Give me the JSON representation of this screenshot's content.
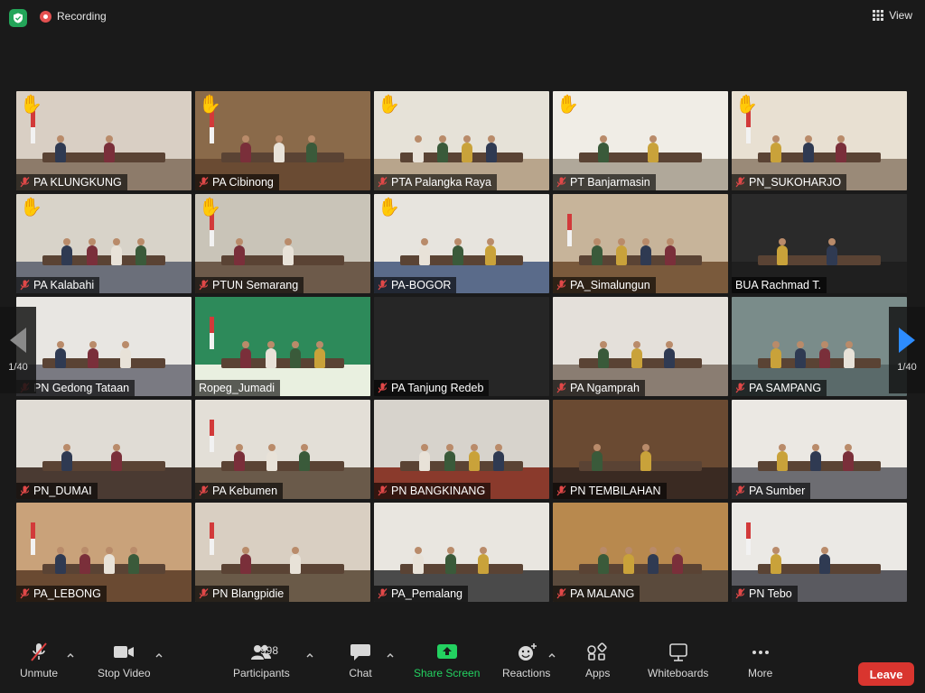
{
  "topbar": {
    "recording_label": "Recording",
    "view_label": "View",
    "icons": [
      "shield-icon",
      "recording-icon",
      "grid-view-icon"
    ]
  },
  "pagination": {
    "left_label": "1/40",
    "right_label": "1/40"
  },
  "participants": [
    {
      "name": "PA KLUNGKUNG",
      "hand_raised": true,
      "muted": true
    },
    {
      "name": "PA Cibinong",
      "hand_raised": true,
      "muted": true
    },
    {
      "name": "PTA Palangka Raya",
      "hand_raised": true,
      "muted": true
    },
    {
      "name": "PT Banjarmasin",
      "hand_raised": true,
      "muted": true
    },
    {
      "name": "PN_SUKOHARJO",
      "hand_raised": true,
      "muted": true
    },
    {
      "name": "PA Kalabahi",
      "hand_raised": true,
      "muted": true
    },
    {
      "name": "PTUN Semarang",
      "hand_raised": true,
      "muted": true
    },
    {
      "name": "PA-BOGOR",
      "hand_raised": true,
      "muted": true
    },
    {
      "name": "PA_Simalungun",
      "hand_raised": false,
      "muted": true
    },
    {
      "name": "BUA Rachmad T.",
      "hand_raised": false,
      "muted": false
    },
    {
      "name": "PN Gedong Tataan",
      "hand_raised": false,
      "muted": true
    },
    {
      "name": "Ropeg_Jumadi",
      "hand_raised": false,
      "muted": false,
      "speaking": true
    },
    {
      "name": "PA Tanjung Redeb",
      "hand_raised": false,
      "muted": true,
      "video_off": true
    },
    {
      "name": "PA Ngamprah",
      "hand_raised": false,
      "muted": true
    },
    {
      "name": "PA SAMPANG",
      "hand_raised": false,
      "muted": true
    },
    {
      "name": "PN_DUMAI",
      "hand_raised": false,
      "muted": true
    },
    {
      "name": "PA Kebumen",
      "hand_raised": false,
      "muted": true
    },
    {
      "name": "PN BANGKINANG",
      "hand_raised": false,
      "muted": true
    },
    {
      "name": "PN TEMBILAHAN",
      "hand_raised": false,
      "muted": true
    },
    {
      "name": "PA Sumber",
      "hand_raised": false,
      "muted": true
    },
    {
      "name": "PA_LEBONG",
      "hand_raised": false,
      "muted": true
    },
    {
      "name": "PN Blangpidie",
      "hand_raised": false,
      "muted": true
    },
    {
      "name": "PA_Pemalang",
      "hand_raised": false,
      "muted": true
    },
    {
      "name": "PA MALANG",
      "hand_raised": false,
      "muted": true
    },
    {
      "name": "PN Tebo",
      "hand_raised": false,
      "muted": true
    }
  ],
  "toolbar": {
    "unmute": "Unmute",
    "stop_video": "Stop Video",
    "participants": "Participants",
    "participants_count": "998",
    "chat": "Chat",
    "share_screen": "Share Screen",
    "reactions": "Reactions",
    "apps": "Apps",
    "whiteboards": "Whiteboards",
    "more": "More",
    "leave": "Leave"
  },
  "colors": {
    "background": "#1a1a1a",
    "share_green": "#23d160",
    "leave_red": "#d9352f",
    "speaking_outline": "#d6e25a",
    "pager_arrow_blue": "#2d8cff"
  }
}
